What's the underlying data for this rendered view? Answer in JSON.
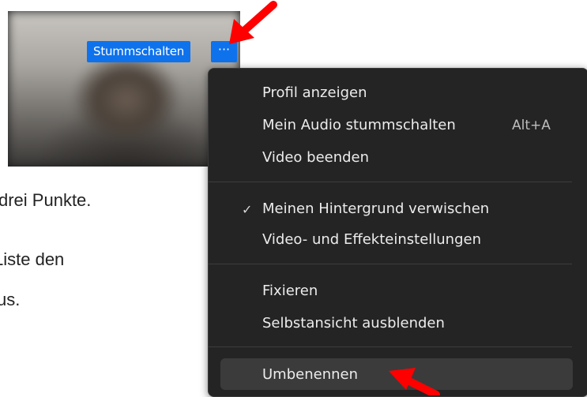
{
  "video": {
    "mute_label": "Stummschalten",
    "more_label": "···"
  },
  "background_text": {
    "line1": "drei Punkte.",
    "line2": "Liste den",
    "line3": "us."
  },
  "menu": {
    "items": [
      {
        "label": "Profil anzeigen"
      },
      {
        "label": "Mein Audio stummschalten",
        "shortcut": "Alt+A"
      },
      {
        "label": "Video beenden"
      },
      {
        "label": "Meinen Hintergrund verwischen",
        "checked": true
      },
      {
        "label": "Video- und Effekteinstellungen"
      },
      {
        "label": "Fixieren"
      },
      {
        "label": "Selbstansicht ausblenden"
      },
      {
        "label": "Umbenennen",
        "highlighted": true
      }
    ],
    "check_glyph": "✓"
  },
  "colors": {
    "accent": "#0e72ed",
    "menu_bg": "#242424",
    "arrow": "#ff0000"
  },
  "icons": [
    "red-arrow-annotation"
  ]
}
